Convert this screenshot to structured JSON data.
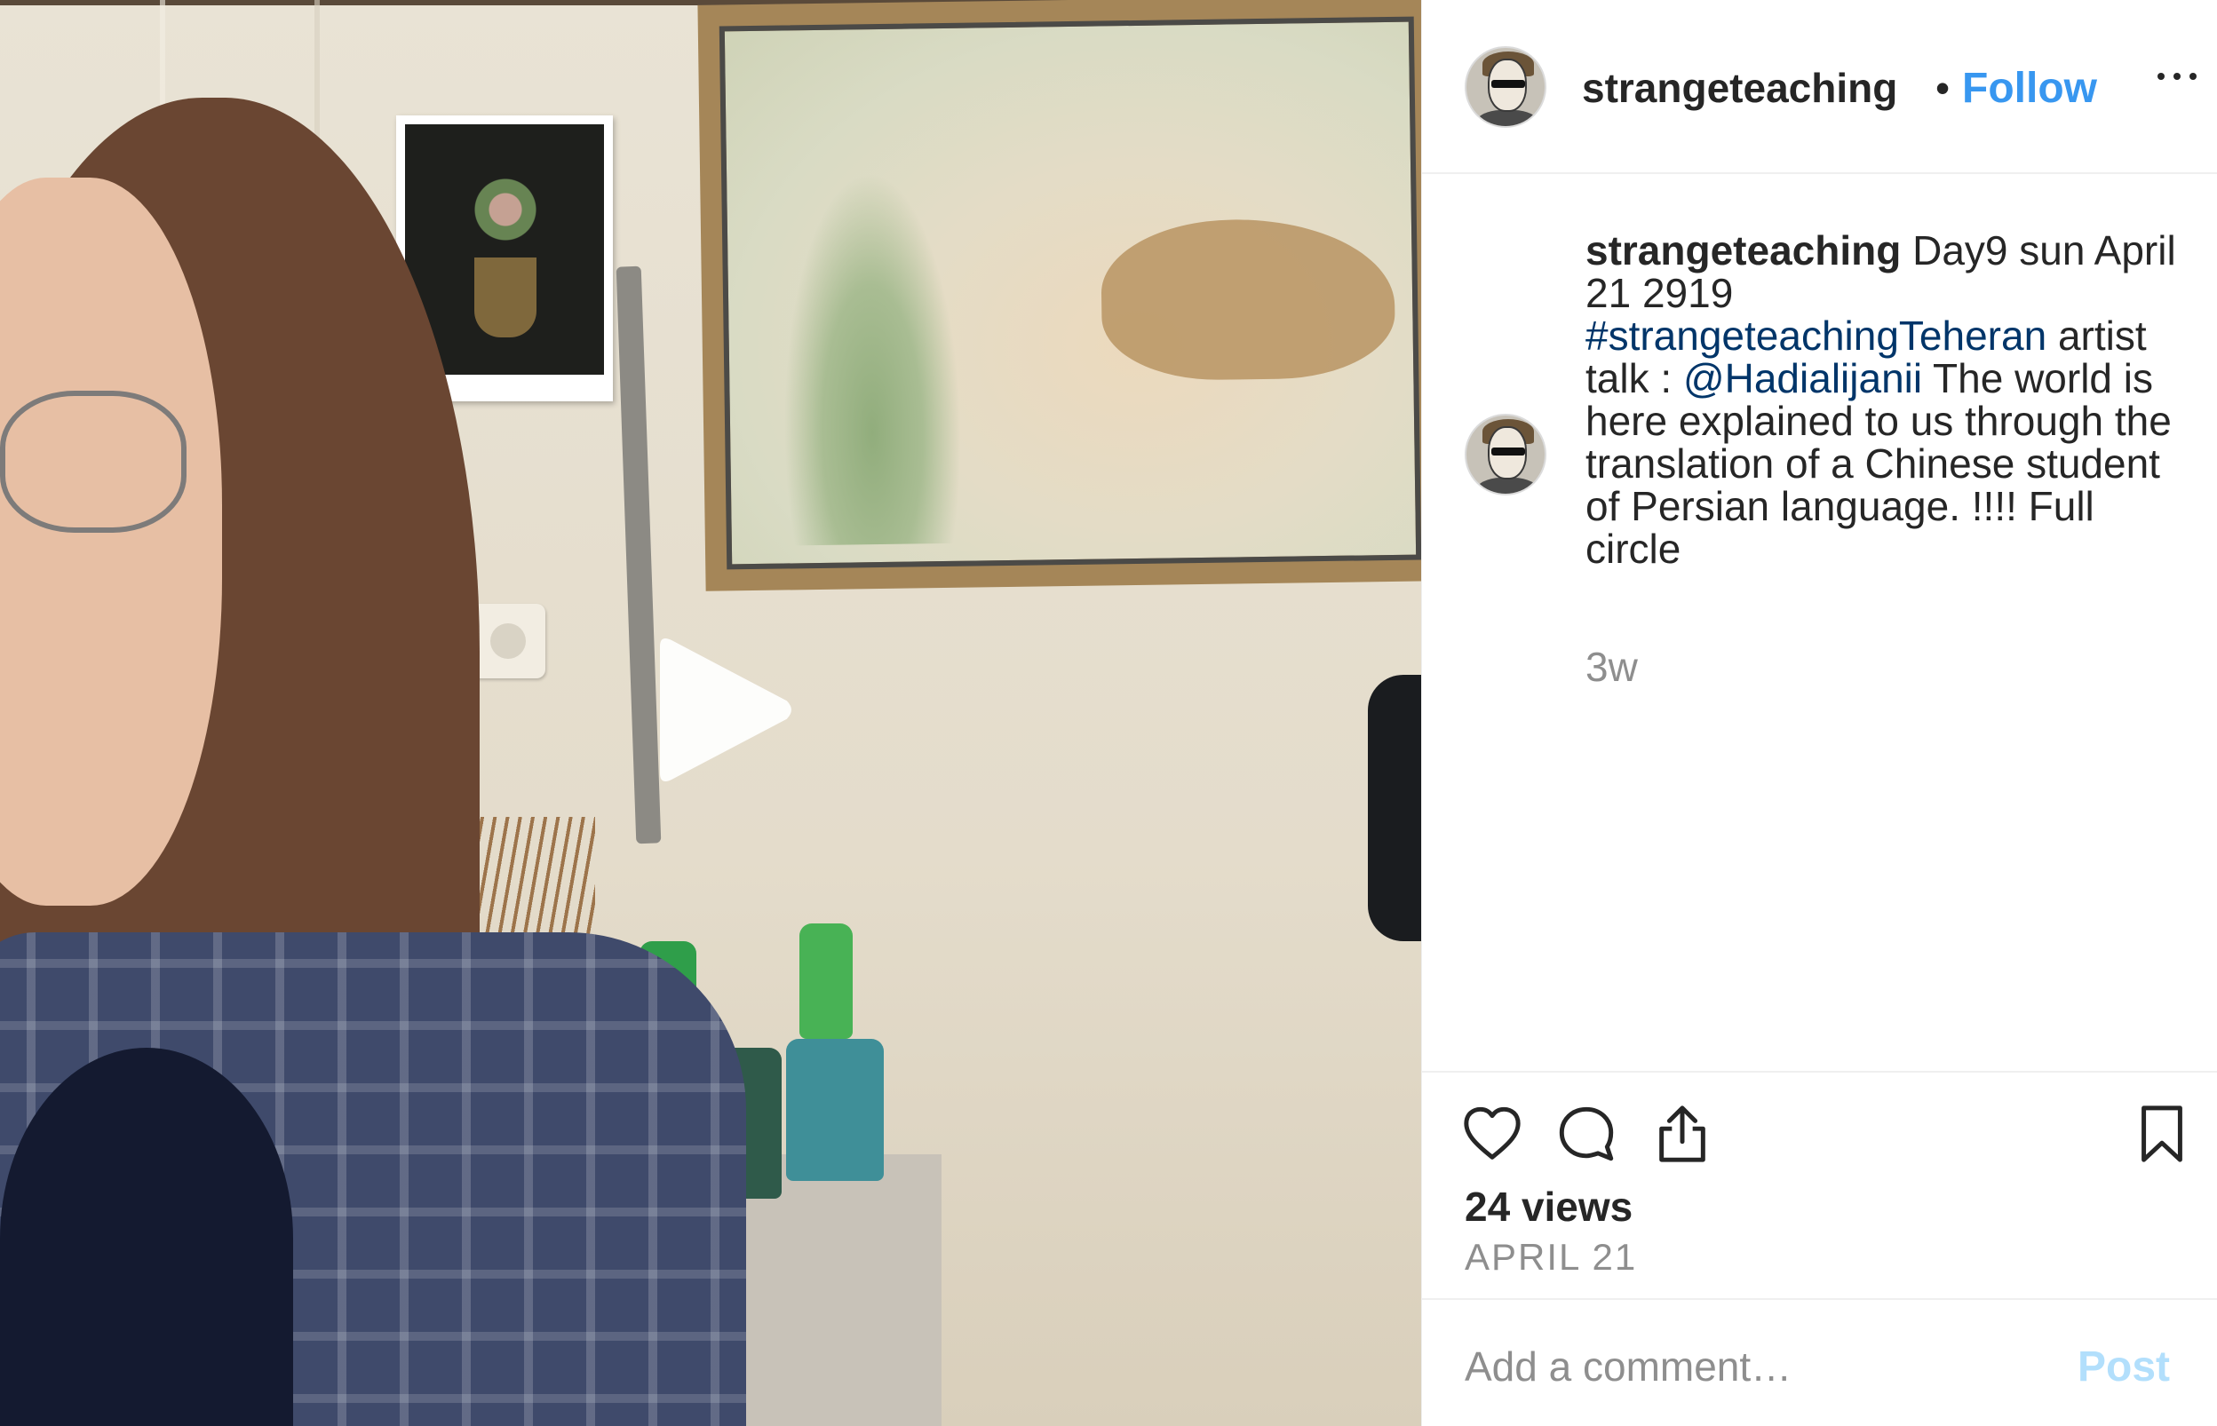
{
  "post": {
    "username": "strangeteaching",
    "separator": "•",
    "follow_label": "Follow",
    "more_options_icon": "more-horizontal-icon"
  },
  "caption": {
    "username": "strangeteaching",
    "text_1": " Day9 sun April 21 2919 ",
    "hashtag": "#strangeteachingTeheran",
    "text_2": " artist talk : ",
    "mention": "@Hadialijanii",
    "text_3": " The world is here explained to us through the translation of a Chinese student of Persian language. !!!! Full circle",
    "time_ago": "3w"
  },
  "actions": {
    "like_icon": "heart-icon",
    "comment_icon": "comment-icon",
    "share_icon": "share-icon",
    "save_icon": "bookmark-icon",
    "views": "24 views",
    "date": "APRIL 21"
  },
  "comment": {
    "placeholder": "Add a comment…",
    "post_label": "Post"
  },
  "colors": {
    "accent": "#3897f0",
    "link": "#003569",
    "muted": "#8e8e8e",
    "post_disabled": "#b2dffc"
  }
}
